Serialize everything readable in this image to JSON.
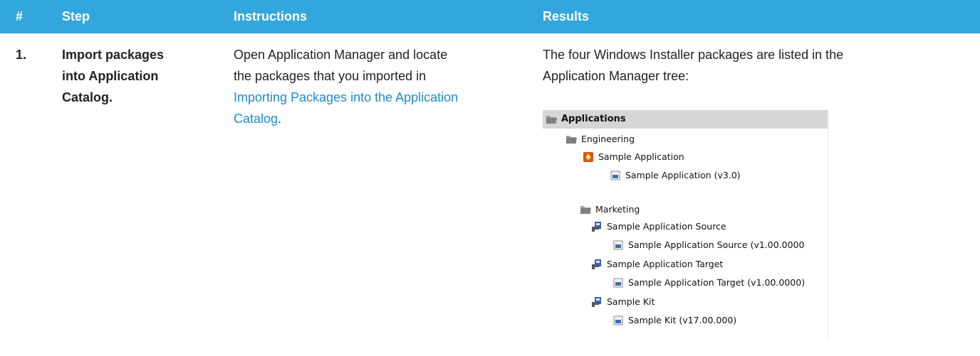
{
  "table": {
    "headers": {
      "num": "#",
      "step": "Step",
      "instructions": "Instructions",
      "results": "Results"
    },
    "row": {
      "number": "1.",
      "step": [
        "Import packages",
        "into Application",
        "Catalog."
      ],
      "instructions": {
        "lines": [
          "Open Application Manager and locate",
          "the packages that you imported in"
        ],
        "link_lines": [
          "Importing Packages into the Application",
          "Catalog"
        ],
        "trailing": "."
      },
      "results": {
        "lines": [
          "The four Windows Installer packages are listed in the",
          "Application Manager tree:"
        ]
      }
    }
  },
  "tree": {
    "root": "Applications",
    "nodes": {
      "engineering": "Engineering",
      "sample_app": "Sample Application",
      "sample_app_pkg": "Sample Application (v3.0)",
      "marketing": "Marketing",
      "source": "Sample Application Source",
      "source_pkg": "Sample Application Source (v1.00.0000",
      "target": "Sample Application Target",
      "target_pkg": "Sample Application Target (v1.00.0000)",
      "kit": "Sample Kit",
      "kit_pkg": "Sample Kit (v17.00.000)"
    },
    "icons": {
      "folder": "folder-icon",
      "app": "application-icon",
      "msi": "msi-package-icon",
      "installer": "installer-icon"
    }
  }
}
